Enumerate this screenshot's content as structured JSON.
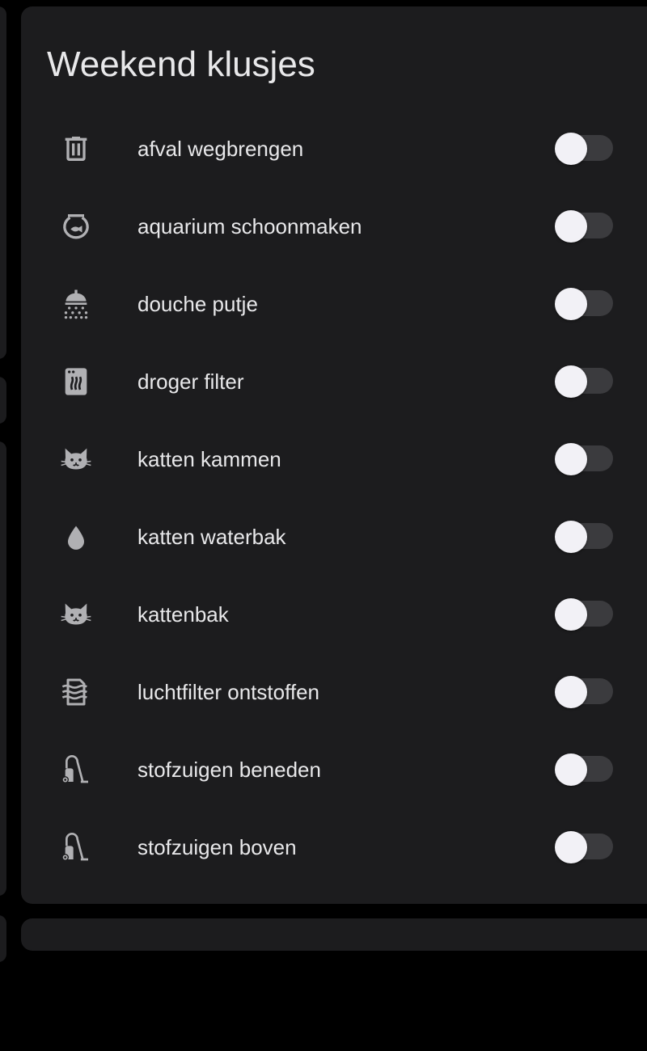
{
  "card": {
    "title": "Weekend klusjes"
  },
  "colors": {
    "background": "#000000",
    "card": "#1c1c1e",
    "text": "#e8e8ea",
    "icon": "#b0b0b3",
    "toggle_track_off": "#3b3b3e",
    "toggle_thumb": "#f2f1f6"
  },
  "items": [
    {
      "label": "afval wegbrengen",
      "icon": "trash-can-icon",
      "on": false
    },
    {
      "label": "aquarium schoonmaken",
      "icon": "fishbowl-icon",
      "on": false
    },
    {
      "label": "douche putje",
      "icon": "shower-head-icon",
      "on": false
    },
    {
      "label": "droger filter",
      "icon": "tumble-dryer-icon",
      "on": false
    },
    {
      "label": "katten kammen",
      "icon": "cat-icon",
      "on": false
    },
    {
      "label": "katten waterbak",
      "icon": "water-drop-icon",
      "on": false
    },
    {
      "label": "kattenbak",
      "icon": "cat-icon",
      "on": false
    },
    {
      "label": "luchtfilter ontstoffen",
      "icon": "air-filter-icon",
      "on": false
    },
    {
      "label": "stofzuigen beneden",
      "icon": "vacuum-cleaner-icon",
      "on": false
    },
    {
      "label": "stofzuigen boven",
      "icon": "vacuum-cleaner-icon",
      "on": false
    }
  ]
}
